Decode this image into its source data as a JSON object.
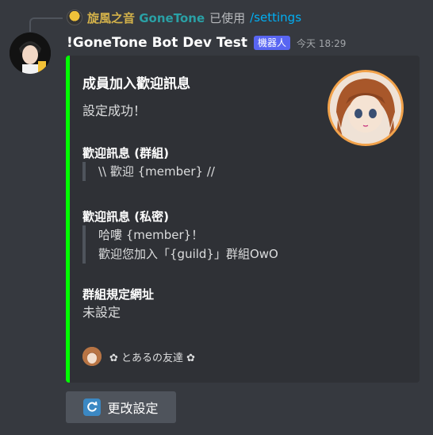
{
  "reply": {
    "user_zh": "旋風之音",
    "user_en": "GoneTone",
    "used_text": "已使用",
    "command": "/settings"
  },
  "message": {
    "username": "!GoneTone Bot Dev Test",
    "badge": "機器人",
    "timestamp": "今天 18:29"
  },
  "embed": {
    "color": "#00ff00",
    "title": "成員加入歡迎訊息",
    "description": "設定成功！",
    "fields": [
      {
        "name": "歡迎訊息 (群組)",
        "lines": [
          "\\\\ 歡迎 {member} //"
        ]
      },
      {
        "name": "歡迎訊息 (私密)",
        "lines": [
          "哈嘍 {member}！",
          "歡迎您加入「{guild}」群組OwO"
        ]
      },
      {
        "name": "群組規定網址",
        "value": "未設定"
      }
    ],
    "footer": "✿ とあるの友達 ✿"
  },
  "button": {
    "label": "更改設定",
    "icon": "refresh-icon"
  }
}
